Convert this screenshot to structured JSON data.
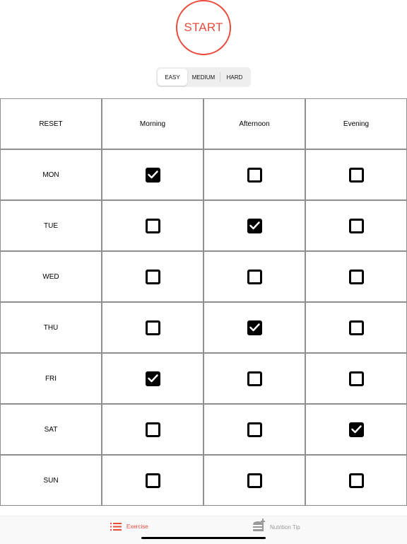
{
  "start_button": {
    "label": "START",
    "color": "#e74c3c"
  },
  "difficulty": {
    "options": [
      "EASY",
      "MEDIUM",
      "HARD"
    ],
    "selected": "EASY"
  },
  "schedule": {
    "reset_label": "RESET",
    "columns": [
      "Morning",
      "Afternoon",
      "Evening"
    ],
    "rows": [
      {
        "day": "MON",
        "checks": [
          true,
          false,
          false
        ]
      },
      {
        "day": "TUE",
        "checks": [
          false,
          true,
          false
        ]
      },
      {
        "day": "WED",
        "checks": [
          false,
          false,
          false
        ]
      },
      {
        "day": "THU",
        "checks": [
          false,
          true,
          false
        ]
      },
      {
        "day": "FRI",
        "checks": [
          true,
          false,
          false
        ]
      },
      {
        "day": "SAT",
        "checks": [
          false,
          false,
          true
        ]
      },
      {
        "day": "SUN",
        "checks": [
          false,
          false,
          false
        ]
      }
    ]
  },
  "tabbar": {
    "tabs": [
      {
        "label": "Exercise",
        "icon": "list-icon",
        "active": true
      },
      {
        "label": "Nutrition Tip",
        "icon": "burger-icon",
        "active": false
      }
    ],
    "active_color": "#e74c3c",
    "inactive_color": "#999999"
  }
}
